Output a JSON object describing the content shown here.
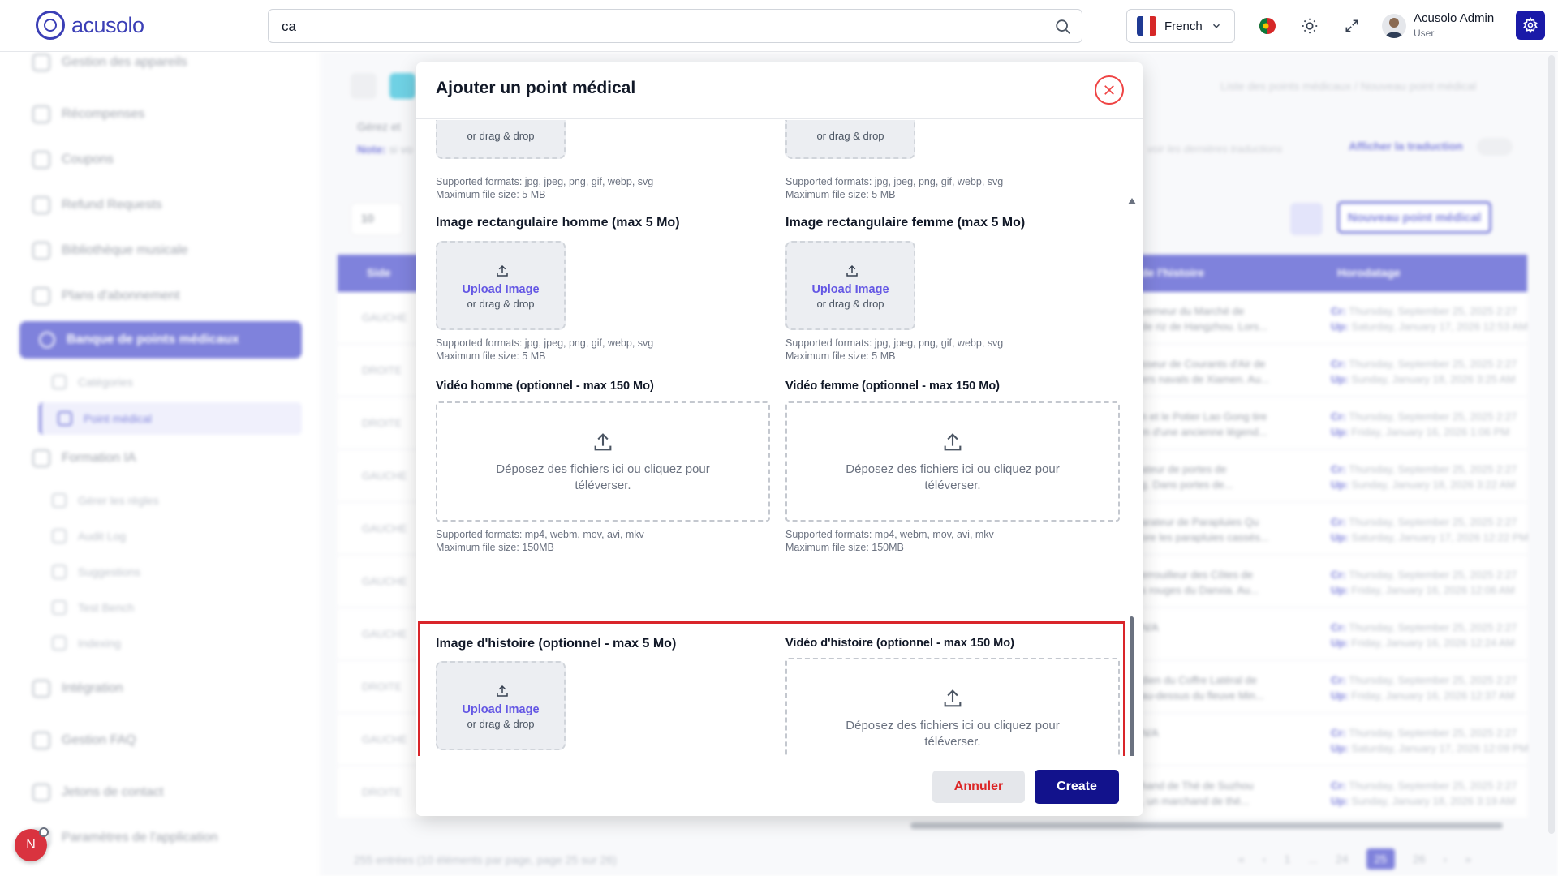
{
  "app": {
    "logo_text": "acusolo",
    "search_value": "ca",
    "language": "French",
    "user_name": "Acusolo Admin",
    "user_role": "User",
    "brand_color": "#3b3fc9"
  },
  "sidebar": {
    "items": [
      {
        "label": "Gestion des appareils"
      },
      {
        "label": "Récompenses"
      },
      {
        "label": "Coupons"
      },
      {
        "label": "Refund Requests"
      },
      {
        "label": "Bibliothèque musicale"
      },
      {
        "label": "Plans d'abonnement"
      }
    ],
    "active": {
      "label": "Banque de points médicaux"
    },
    "sub_items": [
      {
        "label": "Catégories"
      }
    ],
    "sub_active": {
      "label": "Point médical"
    },
    "formation": {
      "label": "Formation IA"
    },
    "formation_sub": [
      {
        "label": "Gérer les règles"
      },
      {
        "label": "Audit Log"
      },
      {
        "label": "Suggestions"
      },
      {
        "label": "Test Bench"
      },
      {
        "label": "Indexing"
      }
    ],
    "bottom_items": [
      {
        "label": "Intégration"
      },
      {
        "label": "Gestion FAQ"
      },
      {
        "label": "Jetons de contact"
      },
      {
        "label": "Paramètres de l'application"
      }
    ]
  },
  "page": {
    "breadcrumb": "Liste des points médicaux  /  Nouveau point médical",
    "info_line1": "Gérez et",
    "info_note": "Note:",
    "info_note_text": "si vo",
    "translate_hint": "voir les dernières traductions",
    "translate_label": "Afficher la traduction",
    "per_page": "10",
    "new_button": "Nouveau point médical",
    "columns": {
      "side": "Side",
      "story": "de l'histoire",
      "timestamp": "Horodatage"
    },
    "rows": [
      {
        "side": "GAUCHE",
        "story1": "verneur du Marché de",
        "story2": "de riz de Hangzhou. Lors...",
        "cr": "Thursday, September 25, 2025 2:27",
        "up": "Saturday, January 17, 2026 12:53 AM"
      },
      {
        "side": "DROITE",
        "story1": "sseur de Courants d'Air de",
        "story2": "ers navals de Xiamen. Au...",
        "cr": "Thursday, September 25, 2025 2:27",
        "up": "Sunday, January 18, 2026 3:25 AM"
      },
      {
        "side": "DROITE",
        "story1": "n et le Potier Lao Gong tire",
        "story2": "m d'une ancienne légend...",
        "cr": "Thursday, September 25, 2025 2:27",
        "up": "Friday, January 16, 2026 1:06 PM"
      },
      {
        "side": "GAUCHE",
        "story1": "ateur de portes de",
        "story2": "g. Dans portes de...",
        "cr": "Thursday, September 25, 2025 2:27",
        "up": "Sunday, January 18, 2026 3:22 AM"
      },
      {
        "side": "GAUCHE",
        "story1": "arateur de Parapluies Qu",
        "story2": "ore les parapluies cassés...",
        "cr": "Thursday, September 25, 2025 2:27",
        "up": "Saturday, January 17, 2026 12:22 PM"
      },
      {
        "side": "GAUCHE",
        "story1": "errouilleur des Côtes de",
        "story2": "s rouges du Danxia. Au...",
        "cr": "Thursday, September 25, 2025 2:27",
        "up": "Friday, January 16, 2026 12:06 AM"
      },
      {
        "side": "GAUCHE",
        "story1": "N/A",
        "story2": "",
        "cr": "Thursday, September 25, 2025 2:27",
        "up": "Friday, January 16, 2026 12:24 AM"
      },
      {
        "side": "DROITE",
        "story1": "dien du Coffre Latéral de",
        "story2": "au-dessus du fleuve Min...",
        "cr": "Thursday, September 25, 2025 2:27",
        "up": "Friday, January 16, 2026 12:37 AM"
      },
      {
        "side": "GAUCHE",
        "story1": "N/A",
        "story2": "",
        "cr": "Thursday, September 25, 2025 2:27",
        "up": "Saturday, January 17, 2026 12:09 PM"
      },
      {
        "side": "DROITE",
        "story1": "hand de Thé de Suzhou",
        "story2": ", un marchand de thé...",
        "cr": "Thursday, September 25, 2025 2:27",
        "up": "Sunday, January 18, 2026 3:19 AM"
      }
    ],
    "cr_label": "Cr:",
    "up_label": "Up:",
    "footer": "255 entrées (10 éléments par page, page 25 sur 26)",
    "pager": [
      "«",
      "‹",
      "1",
      "...",
      "24",
      "25",
      "26",
      "›",
      "»"
    ]
  },
  "modal": {
    "title": "Ajouter un point médical",
    "drag_drop": "or drag & drop",
    "upload_image": "Upload Image",
    "img_formats": "Supported formats: jpg, jpeg, png, gif, webp, svg",
    "img_max": "Maximum file size: 5 MB",
    "vid_formats": "Supported formats: mp4, webm, mov, avi, mkv",
    "vid_max": "Maximum file size: 150MB",
    "vid_drop_text": "Déposez des fichiers ici ou cliquez pour téléverser.",
    "rect_male_label": "Image rectangulaire homme (max 5 Mo)",
    "rect_female_label": "Image rectangulaire femme (max 5 Mo)",
    "video_male_label": "Vidéo homme (optionnel - max 150 Mo)",
    "video_female_label": "Vidéo femme (optionnel - max 150 Mo)",
    "story_image_label": "Image d'histoire (optionnel - max 5 Mo)",
    "story_video_label": "Vidéo d'histoire (optionnel - max 150 Mo)",
    "cancel": "Annuler",
    "create": "Create"
  }
}
